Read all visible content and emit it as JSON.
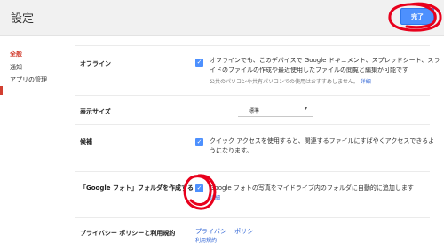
{
  "header": {
    "title": "設定",
    "done_label": "完了"
  },
  "sidebar": {
    "items": [
      {
        "label": "全般"
      },
      {
        "label": "通知"
      },
      {
        "label": "アプリの管理"
      }
    ]
  },
  "settings": {
    "offline": {
      "label": "オフライン",
      "line1": "オフラインでも、このデバイスで Google ドキュメント、スプレッドシート、スラ",
      "line2": "イドのファイルの作成や最近使用したファイルの閲覧と編集が可能です",
      "note": "公共のパソコンや共有パソコンでの使用はおすすめしません。",
      "note_link": "詳細",
      "checked": true
    },
    "display_size": {
      "label": "表示サイズ",
      "value": "標準",
      "arrow": "▾"
    },
    "suggestions": {
      "label": "候補",
      "line1": "クイック アクセスを使用すると、関連するファイルにすばやくアクセスできるよ",
      "line2": "うになります。",
      "checked": true
    },
    "google_photos": {
      "label": "「Google フォト」フォルダを作成する",
      "line1": "Google フォトの写真をマイドライブ内のフォルダに自動的に追加します",
      "link": "詳細",
      "checked": true
    },
    "privacy": {
      "label": "プライバシー ポリシーと利用規約",
      "privacy_link": "プライバシー ポリシー",
      "terms_link": "利用規約"
    }
  },
  "colors": {
    "accent": "#4d90fe",
    "active_nav": "#d23f31",
    "annotation": "#e8001c"
  },
  "icons": {
    "checkbox": "check-mark",
    "dropdown": "triangle-down"
  }
}
